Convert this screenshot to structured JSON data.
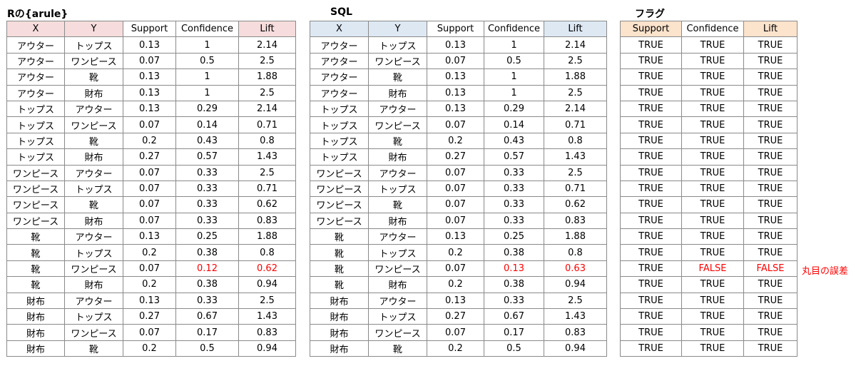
{
  "r_table": {
    "title": "Rの{arule}",
    "headers": [
      "X",
      "Y",
      "Support",
      "Confidence",
      "Lift"
    ],
    "rows": [
      [
        "アウター",
        "トップス",
        "0.13",
        "1",
        "2.14"
      ],
      [
        "アウター",
        "ワンピース",
        "0.07",
        "0.5",
        "2.5"
      ],
      [
        "アウター",
        "靴",
        "0.13",
        "1",
        "1.88"
      ],
      [
        "アウター",
        "財布",
        "0.13",
        "1",
        "2.5"
      ],
      [
        "トップス",
        "アウター",
        "0.13",
        "0.29",
        "2.14"
      ],
      [
        "トップス",
        "ワンピース",
        "0.07",
        "0.14",
        "0.71"
      ],
      [
        "トップス",
        "靴",
        "0.2",
        "0.43",
        "0.8"
      ],
      [
        "トップス",
        "財布",
        "0.27",
        "0.57",
        "1.43"
      ],
      [
        "ワンピース",
        "アウター",
        "0.07",
        "0.33",
        "2.5"
      ],
      [
        "ワンピース",
        "トップス",
        "0.07",
        "0.33",
        "0.71"
      ],
      [
        "ワンピース",
        "靴",
        "0.07",
        "0.33",
        "0.62"
      ],
      [
        "ワンピース",
        "財布",
        "0.07",
        "0.33",
        "0.83"
      ],
      [
        "靴",
        "アウター",
        "0.13",
        "0.25",
        "1.88"
      ],
      [
        "靴",
        "トップス",
        "0.2",
        "0.38",
        "0.8"
      ],
      [
        "靴",
        "ワンピース",
        "0.07",
        "0.12",
        "0.62"
      ],
      [
        "靴",
        "財布",
        "0.2",
        "0.38",
        "0.94"
      ],
      [
        "財布",
        "アウター",
        "0.13",
        "0.33",
        "2.5"
      ],
      [
        "財布",
        "トップス",
        "0.27",
        "0.67",
        "1.43"
      ],
      [
        "財布",
        "ワンピース",
        "0.07",
        "0.17",
        "0.83"
      ],
      [
        "財布",
        "靴",
        "0.2",
        "0.5",
        "0.94"
      ]
    ]
  },
  "sql_table": {
    "title": "SQL",
    "headers": [
      "X",
      "Y",
      "Support",
      "Confidence",
      "Lift"
    ],
    "rows": [
      [
        "アウター",
        "トップス",
        "0.13",
        "1",
        "2.14"
      ],
      [
        "アウター",
        "ワンピース",
        "0.07",
        "0.5",
        "2.5"
      ],
      [
        "アウター",
        "靴",
        "0.13",
        "1",
        "1.88"
      ],
      [
        "アウター",
        "財布",
        "0.13",
        "1",
        "2.5"
      ],
      [
        "トップス",
        "アウター",
        "0.13",
        "0.29",
        "2.14"
      ],
      [
        "トップス",
        "ワンピース",
        "0.07",
        "0.14",
        "0.71"
      ],
      [
        "トップス",
        "靴",
        "0.2",
        "0.43",
        "0.8"
      ],
      [
        "トップス",
        "財布",
        "0.27",
        "0.57",
        "1.43"
      ],
      [
        "ワンピース",
        "アウター",
        "0.07",
        "0.33",
        "2.5"
      ],
      [
        "ワンピース",
        "トップス",
        "0.07",
        "0.33",
        "0.71"
      ],
      [
        "ワンピース",
        "靴",
        "0.07",
        "0.33",
        "0.62"
      ],
      [
        "ワンピース",
        "財布",
        "0.07",
        "0.33",
        "0.83"
      ],
      [
        "靴",
        "アウター",
        "0.13",
        "0.25",
        "1.88"
      ],
      [
        "靴",
        "トップス",
        "0.2",
        "0.38",
        "0.8"
      ],
      [
        "靴",
        "ワンピース",
        "0.07",
        "0.13",
        "0.63"
      ],
      [
        "靴",
        "財布",
        "0.2",
        "0.38",
        "0.94"
      ],
      [
        "財布",
        "アウター",
        "0.13",
        "0.33",
        "2.5"
      ],
      [
        "財布",
        "トップス",
        "0.27",
        "0.67",
        "1.43"
      ],
      [
        "財布",
        "ワンピース",
        "0.07",
        "0.17",
        "0.83"
      ],
      [
        "財布",
        "靴",
        "0.2",
        "0.5",
        "0.94"
      ]
    ]
  },
  "flag_table": {
    "title": "フラグ",
    "headers": [
      "Support",
      "Confidence",
      "Lift"
    ],
    "rows": [
      [
        "TRUE",
        "TRUE",
        "TRUE"
      ],
      [
        "TRUE",
        "TRUE",
        "TRUE"
      ],
      [
        "TRUE",
        "TRUE",
        "TRUE"
      ],
      [
        "TRUE",
        "TRUE",
        "TRUE"
      ],
      [
        "TRUE",
        "TRUE",
        "TRUE"
      ],
      [
        "TRUE",
        "TRUE",
        "TRUE"
      ],
      [
        "TRUE",
        "TRUE",
        "TRUE"
      ],
      [
        "TRUE",
        "TRUE",
        "TRUE"
      ],
      [
        "TRUE",
        "TRUE",
        "TRUE"
      ],
      [
        "TRUE",
        "TRUE",
        "TRUE"
      ],
      [
        "TRUE",
        "TRUE",
        "TRUE"
      ],
      [
        "TRUE",
        "TRUE",
        "TRUE"
      ],
      [
        "TRUE",
        "TRUE",
        "TRUE"
      ],
      [
        "TRUE",
        "TRUE",
        "TRUE"
      ],
      [
        "TRUE",
        "FALSE",
        "FALSE"
      ],
      [
        "TRUE",
        "TRUE",
        "TRUE"
      ],
      [
        "TRUE",
        "TRUE",
        "TRUE"
      ],
      [
        "TRUE",
        "TRUE",
        "TRUE"
      ],
      [
        "TRUE",
        "TRUE",
        "TRUE"
      ],
      [
        "TRUE",
        "TRUE",
        "TRUE"
      ]
    ]
  },
  "note": "丸目の誤差",
  "colors": {
    "highlight": "#ff0000",
    "r_header": "#f6dcdc",
    "sql_header": "#dde8f3",
    "flag_header": "#fbe3cc"
  }
}
